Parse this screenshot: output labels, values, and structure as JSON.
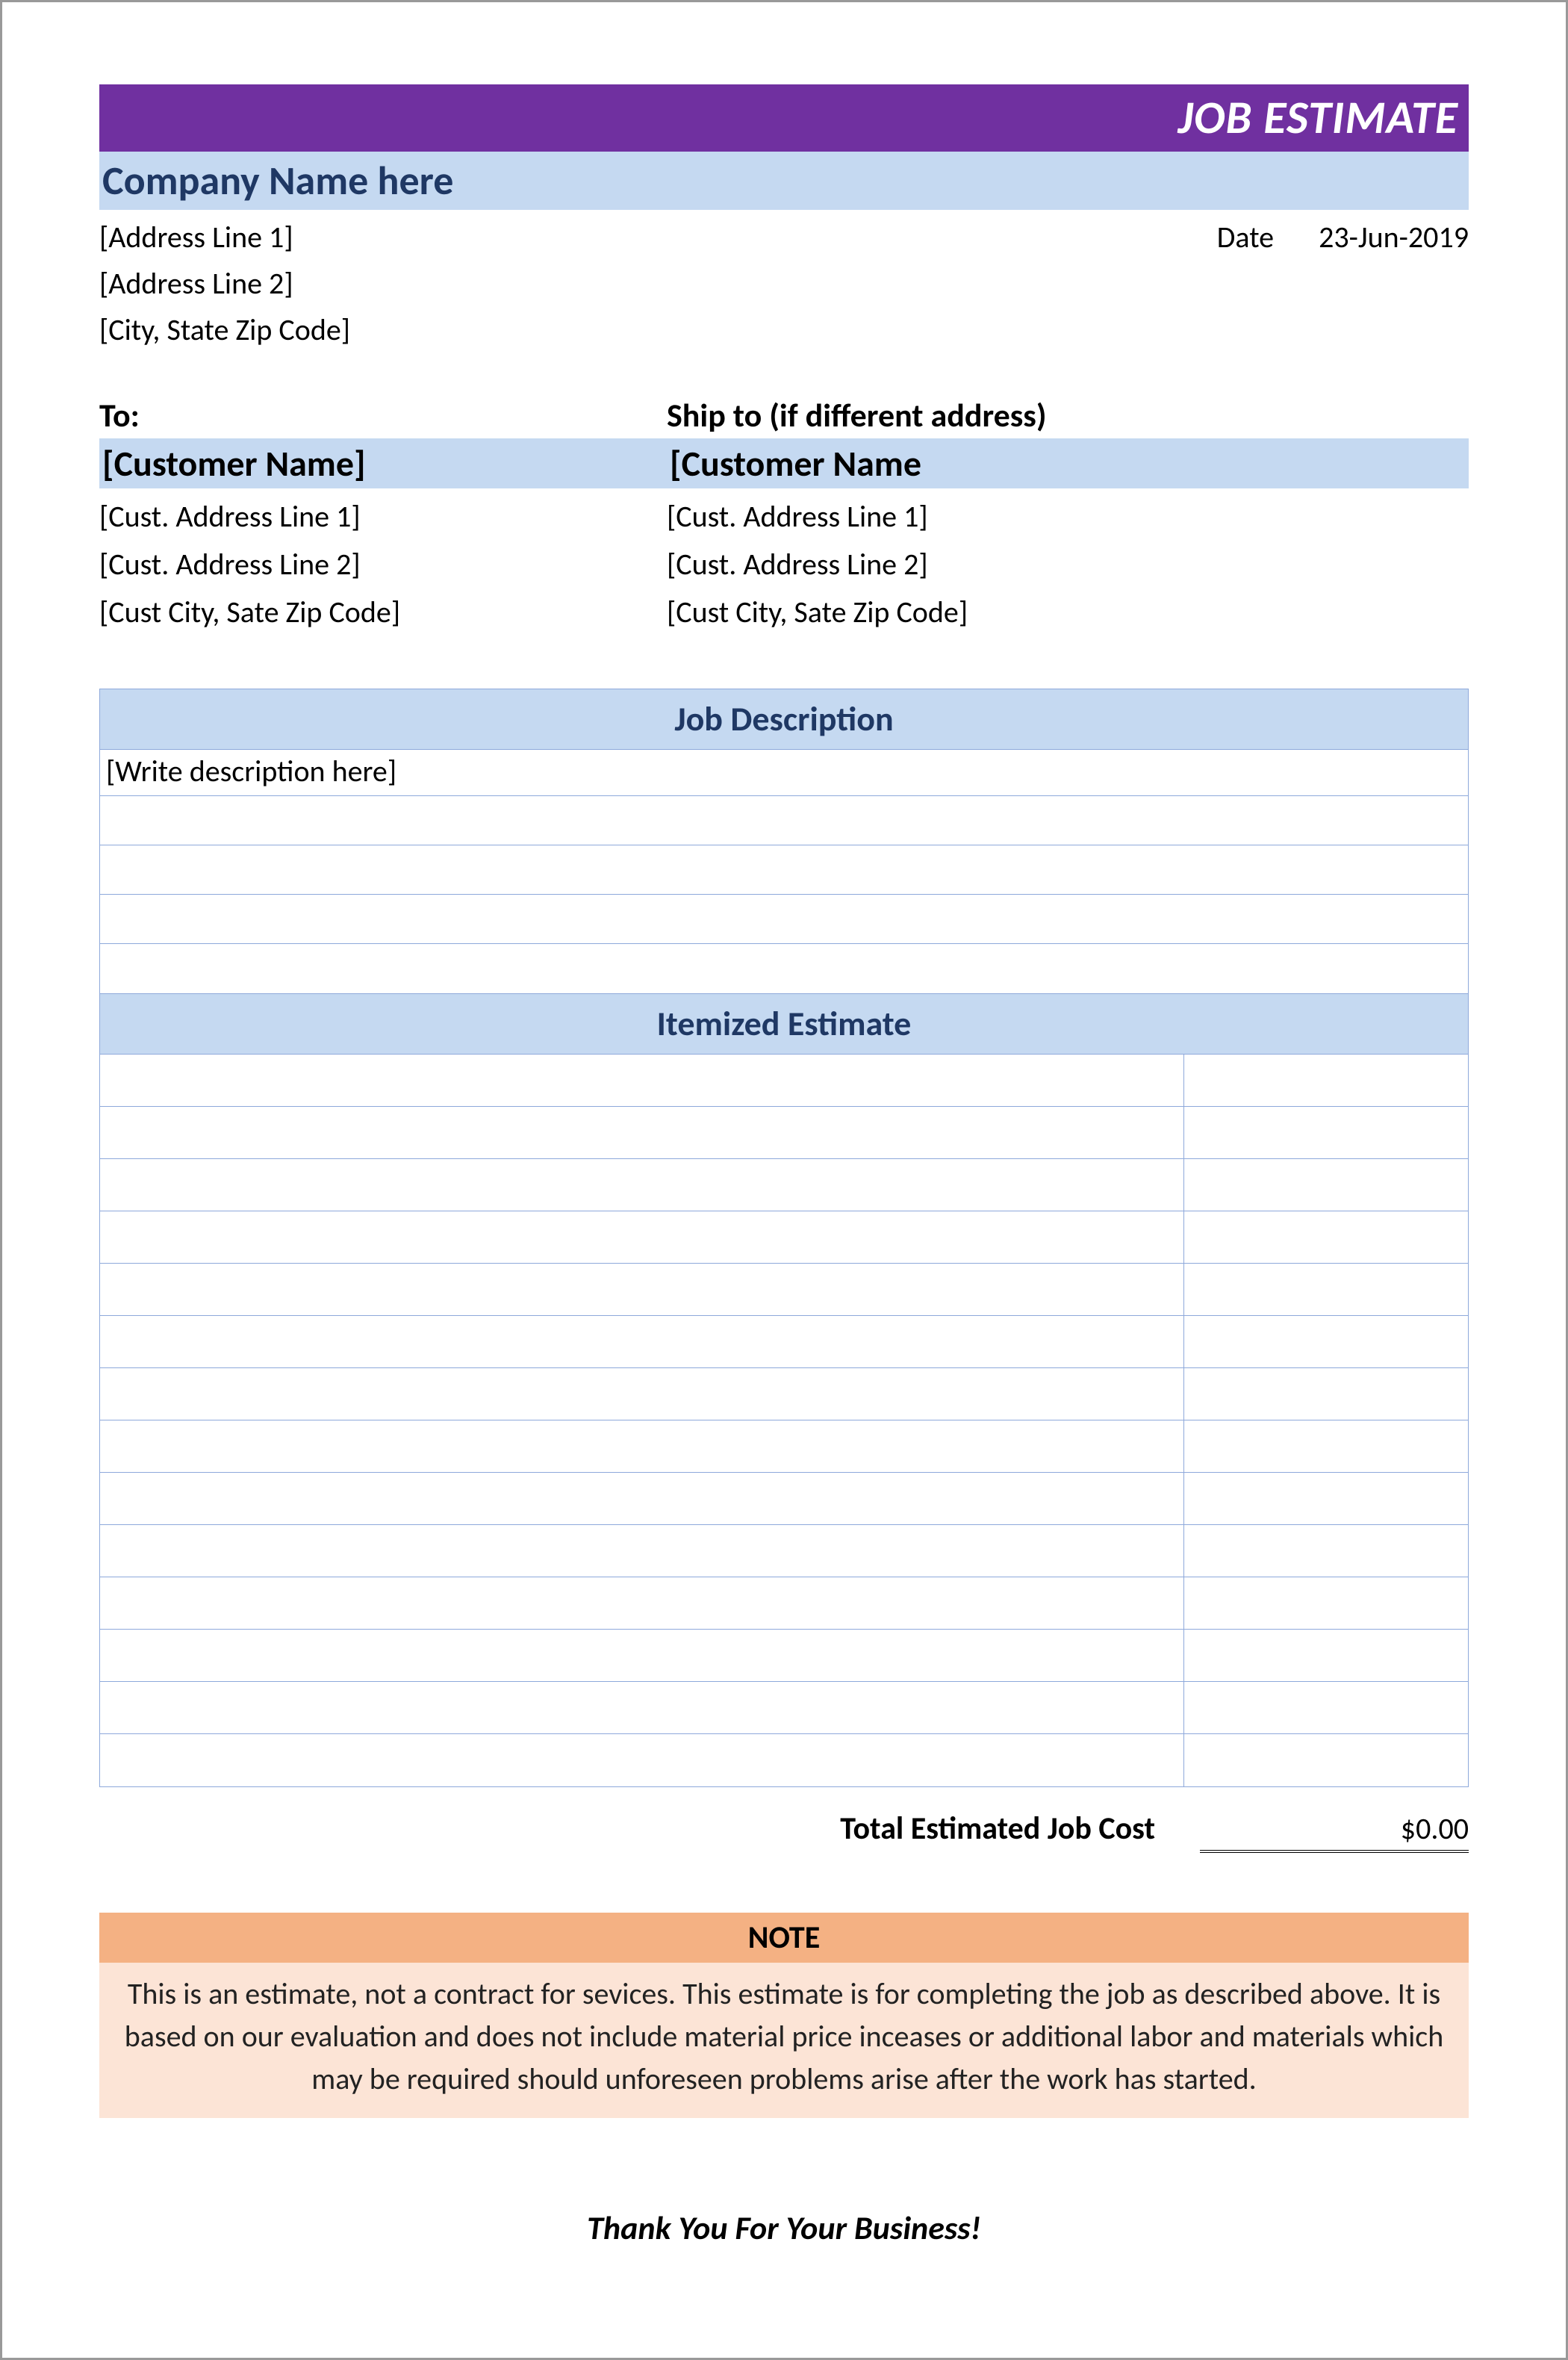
{
  "banner": {
    "title": "JOB ESTIMATE"
  },
  "company": {
    "name": "Company Name here",
    "addr1": "[Address Line 1]",
    "addr2": "[Address Line 2]",
    "city": "[City, State Zip Code]"
  },
  "date": {
    "label": "Date",
    "value": "23-Jun-2019"
  },
  "to": {
    "label": "To:",
    "name": "[Customer Name]",
    "addr1": "[Cust. Address Line 1]",
    "addr2": "[Cust. Address Line 2]",
    "city": "[Cust City, Sate Zip Code]"
  },
  "shipto": {
    "label": "Ship to (if different address)",
    "name": "[Customer Name",
    "addr1": "[Cust. Address Line 1]",
    "addr2": "[Cust. Address Line 2]",
    "city": "[Cust City, Sate Zip Code]"
  },
  "jobdesc": {
    "header": "Job Description",
    "placeholder": "[Write description here]"
  },
  "itemized": {
    "header": "Itemized Estimate"
  },
  "total": {
    "label": "Total Estimated Job Cost",
    "value": "$0.00"
  },
  "note": {
    "header": "NOTE",
    "body": "This is an estimate, not a contract for sevices. This estimate is for completing the job as described above. It is based on our evaluation and does not include material price inceases or additional labor and materials which may be required should unforeseen problems arise after the work has started."
  },
  "footer": {
    "thankyou": "Thank You For Your Business!"
  }
}
